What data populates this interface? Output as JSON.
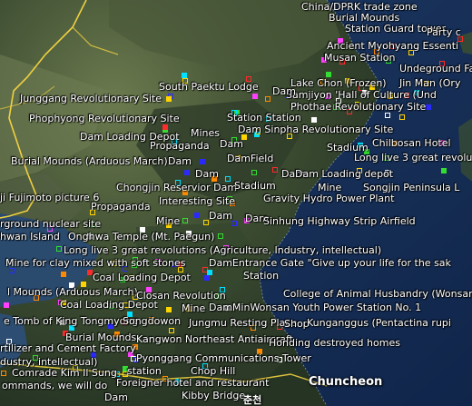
{
  "labels": [
    {
      "text": "China/DPRK trade zone"
    },
    {
      "text": "Burial Mounds"
    },
    {
      "text": "Station Guard tower"
    },
    {
      "text": "Ancient Myohyang Essenti"
    },
    {
      "text": "Party c"
    },
    {
      "text": "Musan Station"
    },
    {
      "text": "Undeground Facil"
    },
    {
      "text": "South Paektu Lodge"
    },
    {
      "text": "Lake Chon (Frozen)"
    },
    {
      "text": "Jin Man (Ory"
    },
    {
      "text": "Samjiyon 'Hall of Culture (Und"
    },
    {
      "text": "Junggang Revolutionary Site"
    },
    {
      "text": "Phothae Revolutionary Site"
    },
    {
      "text": "Phophyong Revolutionary Site"
    },
    {
      "text": "Station Station"
    },
    {
      "text": "Dam Sinpha Revolutionary Site"
    },
    {
      "text": "Mines"
    },
    {
      "text": "Dam Loading Depot"
    },
    {
      "text": "Propaganda"
    },
    {
      "text": "Dam"
    },
    {
      "text": "Stadium"
    },
    {
      "text": "Chilbosan Hotel"
    },
    {
      "text": "Burial Mounds (Arduous March)"
    },
    {
      "text": "Dam"
    },
    {
      "text": "DamField"
    },
    {
      "text": "Long live 3 great revolu"
    },
    {
      "text": "Dam"
    },
    {
      "text": "Dam"
    },
    {
      "text": "Dam Loading depot"
    },
    {
      "text": "Chongjin Reservior Dam"
    },
    {
      "text": "Stadium"
    },
    {
      "text": "Mine"
    },
    {
      "text": "Songjin Peninsula L"
    },
    {
      "text": "ji Fujimoto picture 6"
    },
    {
      "text": "Interesting Site"
    },
    {
      "text": "Gravity Hydro Power Plant"
    },
    {
      "text": "Propaganda"
    },
    {
      "text": "Dam"
    },
    {
      "text": "Mine"
    },
    {
      "text": "Dam"
    },
    {
      "text": "Sinhung Highway Strip Airfield"
    },
    {
      "text": "rground nuclear site"
    },
    {
      "text": "hwan Island"
    },
    {
      "text": "Onghwa Temple (Mt. Paegun)"
    },
    {
      "text": "Long live 3 great revolutions (Agriculture, Industry, intellectual)"
    },
    {
      "text": "Mine for clay mixed with soft stones"
    },
    {
      "text": "DamEntrance Gate \"Give up your life for the sak"
    },
    {
      "text": "Coal Loading Depot"
    },
    {
      "text": "Station"
    },
    {
      "text": "l Mounds (Arduous March)"
    },
    {
      "text": "Closan Revolution"
    },
    {
      "text": "College of Animal Husbandry (Wonsar"
    },
    {
      "text": "Coal Loading Depot"
    },
    {
      "text": "Mine"
    },
    {
      "text": "DamMinWonsan Youth Power Station No. 1"
    },
    {
      "text": "e Tomb of King Tongmyong"
    },
    {
      "text": "Songdowon"
    },
    {
      "text": "Jungmu Resting Place"
    },
    {
      "text": "Shop"
    },
    {
      "text": "Kunganggus (Pentactina rupi"
    },
    {
      "text": "Burial Mounds"
    },
    {
      "text": "Kangwon Northeast Antiaircraft"
    },
    {
      "text": "Honding destroyed homes"
    },
    {
      "text": "rtilizer and Cement Factory"
    },
    {
      "text": "dustry, intellectual)"
    },
    {
      "text": "Pyonggang Communications Tower"
    },
    {
      "text": "Comrade Kim Il Sung"
    },
    {
      "text": "station"
    },
    {
      "text": "Chop Hill"
    },
    {
      "text": "ommands, we will do"
    },
    {
      "text": "Foreigner hotel and restaurant"
    },
    {
      "text": "Kibby Bridge"
    },
    {
      "text": "Dam"
    },
    {
      "text": "Dam"
    }
  ],
  "city": {
    "text": "Chuncheon",
    "text_local": "춘천"
  },
  "marker_colors": [
    "#ffd400",
    "#2a2aff",
    "#ff2a2a",
    "#33dd33",
    "#ff8a00",
    "#ff40ff",
    "#00e0ff",
    "#ffffff"
  ]
}
